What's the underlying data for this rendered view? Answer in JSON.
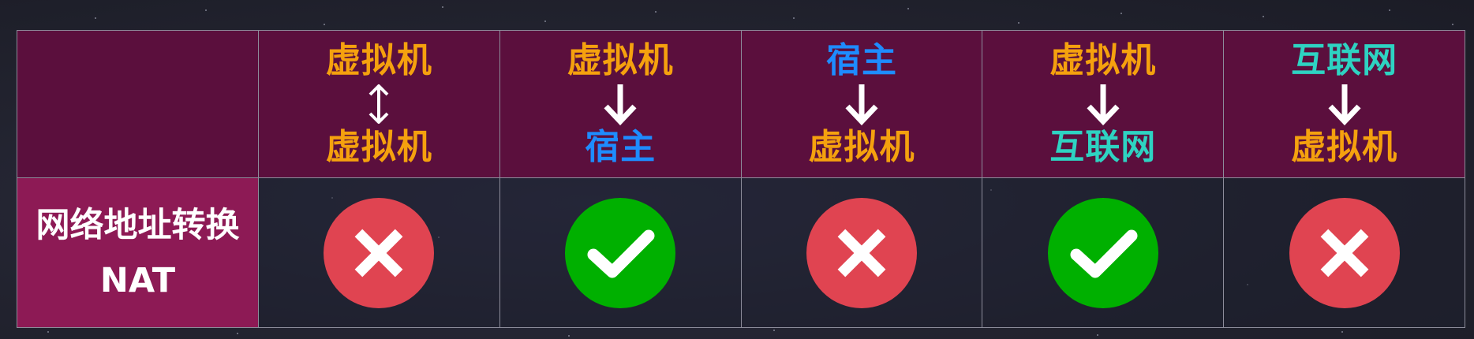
{
  "colors": {
    "vm": "#f5a10e",
    "host": "#1e8cff",
    "internet": "#2ed3c2",
    "deny": "#e04451",
    "allow": "#00b000",
    "header_bg": "#5b0f3d",
    "label_bg": "#8d1a55"
  },
  "row_label": {
    "line1": "网络地址转换",
    "line2": "NAT"
  },
  "columns": [
    {
      "top": "虚拟机",
      "top_kind": "vm",
      "arrow": "bidirectional-arrow-icon",
      "bottom": "虚拟机",
      "bottom_kind": "vm",
      "status": "cross-icon"
    },
    {
      "top": "虚拟机",
      "top_kind": "vm",
      "arrow": "down-arrow-icon",
      "bottom": "宿主",
      "bottom_kind": "host",
      "status": "check-icon"
    },
    {
      "top": "宿主",
      "top_kind": "host",
      "arrow": "down-arrow-icon",
      "bottom": "虚拟机",
      "bottom_kind": "vm",
      "status": "cross-icon"
    },
    {
      "top": "虚拟机",
      "top_kind": "vm",
      "arrow": "down-arrow-icon",
      "bottom": "互联网",
      "bottom_kind": "internet",
      "status": "check-icon"
    },
    {
      "top": "互联网",
      "top_kind": "internet",
      "arrow": "down-arrow-icon",
      "bottom": "虚拟机",
      "bottom_kind": "vm",
      "status": "cross-icon"
    }
  ]
}
